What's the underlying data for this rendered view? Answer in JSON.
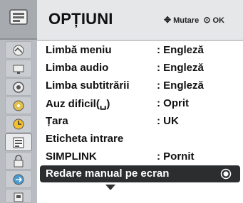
{
  "header": {
    "title": "OPȚIUNI",
    "hint_move": "Mutare",
    "hint_ok": "OK"
  },
  "menu_items": [
    {
      "label": "Limbă meniu",
      "value": ": Engleză"
    },
    {
      "label": "Limba audio",
      "value": ": Engleză"
    },
    {
      "label": "Limba subtitrării",
      "value": ": Engleză"
    },
    {
      "label": "Auz dificil(␣)",
      "value": ": Oprit"
    },
    {
      "label": "Țara",
      "value": ": UK"
    },
    {
      "label": "Eticheta intrare",
      "value": ""
    },
    {
      "label": "SIMPLINK",
      "value": ": Pornit"
    },
    {
      "label": "Redare manual pe ecran",
      "value": ""
    }
  ],
  "icons": [
    "picture-icon",
    "audio-icon",
    "monitor-icon",
    "disc-icon",
    "clock-icon",
    "options-icon",
    "lock-icon",
    "input-icon",
    "usb-icon"
  ],
  "colors": {
    "selected_row": "#2c2d2f",
    "header_bg": "#e6e7e9",
    "icon_column": "#b9bcc0"
  }
}
